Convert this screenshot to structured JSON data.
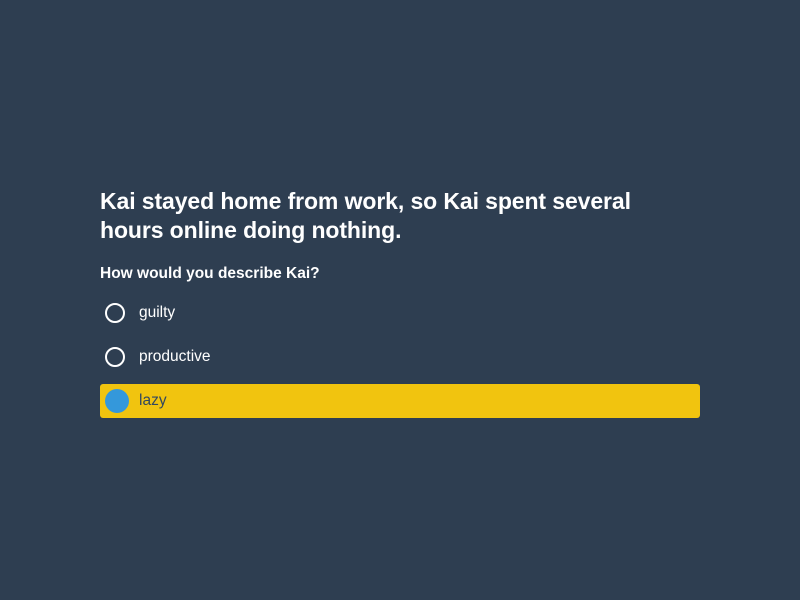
{
  "question": {
    "text": "Kai stayed home from work, so Kai spent several hours online doing nothing.",
    "prompt": "How would you describe Kai?"
  },
  "options": [
    {
      "label": "guilty",
      "selected": false
    },
    {
      "label": "productive",
      "selected": false
    },
    {
      "label": "lazy",
      "selected": true
    }
  ],
  "colors": {
    "background": "#2e3e51",
    "selected_bg": "#f1c40f",
    "selected_radio": "#3498db",
    "selected_text": "#34495e"
  }
}
